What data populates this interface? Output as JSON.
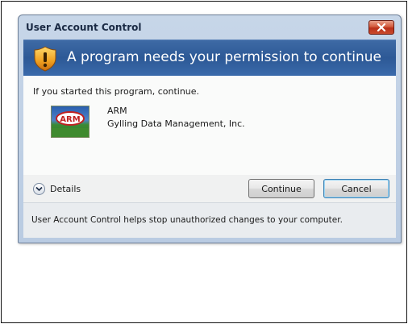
{
  "window": {
    "title": "User Account Control",
    "close_symbol": "✕"
  },
  "header": {
    "message": "A program needs your permission to continue",
    "icon": "shield-warning-icon"
  },
  "content": {
    "intro": "If you started this program, continue.",
    "program": {
      "name": "ARM",
      "publisher": "Gylling Data Management, Inc.",
      "icon": "arm-app-icon",
      "icon_text": "ARM"
    }
  },
  "buttons": {
    "details_label": "Details",
    "continue_label": "Continue",
    "cancel_label": "Cancel"
  },
  "footer": {
    "text": "User Account Control helps stop unauthorized changes to your computer."
  },
  "colors": {
    "header_band": "#2d5996",
    "close_button": "#c94a2c",
    "focus_border": "#3c7fb1"
  }
}
